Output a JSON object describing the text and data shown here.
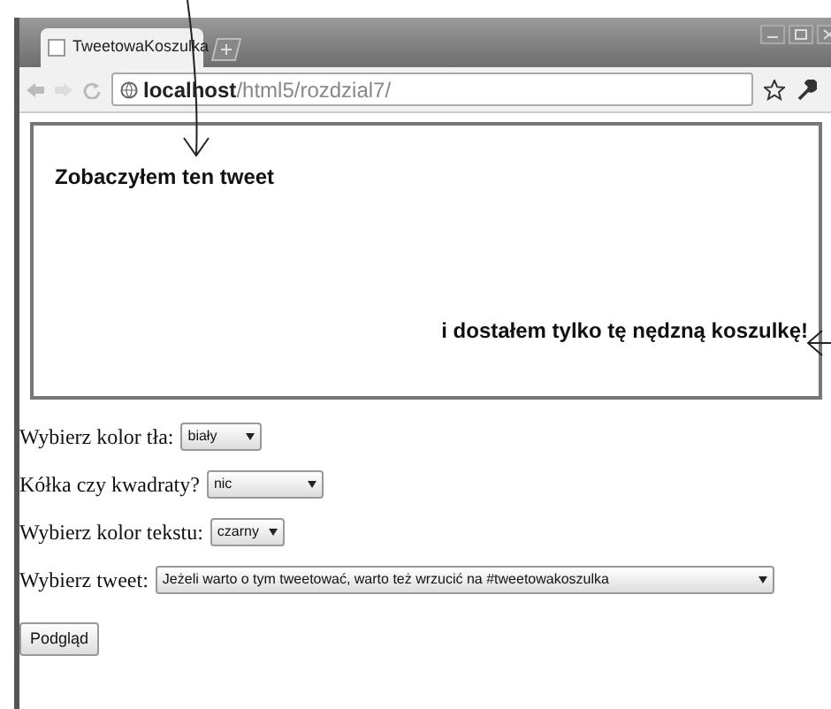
{
  "browser": {
    "tab_title": "TweetowaKoszulka",
    "address": {
      "host": "localhost",
      "path": "/html5/rozdzial7/"
    }
  },
  "canvas": {
    "texts": [
      "Zobaczyłem ten tweet",
      "i dostałem tylko tę nędzną koszulkę!"
    ]
  },
  "form": {
    "fields": [
      {
        "label": "Wybierz kolor tła:",
        "value": "biały"
      },
      {
        "label": "Kółka czy kwadraty?",
        "value": "nic"
      },
      {
        "label": "Wybierz kolor tekstu:",
        "value": "czarny"
      },
      {
        "label": "Wybierz tweet:",
        "value": "Jeżeli warto o tym tweetować, warto też wrzucić na #tweetowakoszulka"
      }
    ],
    "button": "Podgląd"
  }
}
